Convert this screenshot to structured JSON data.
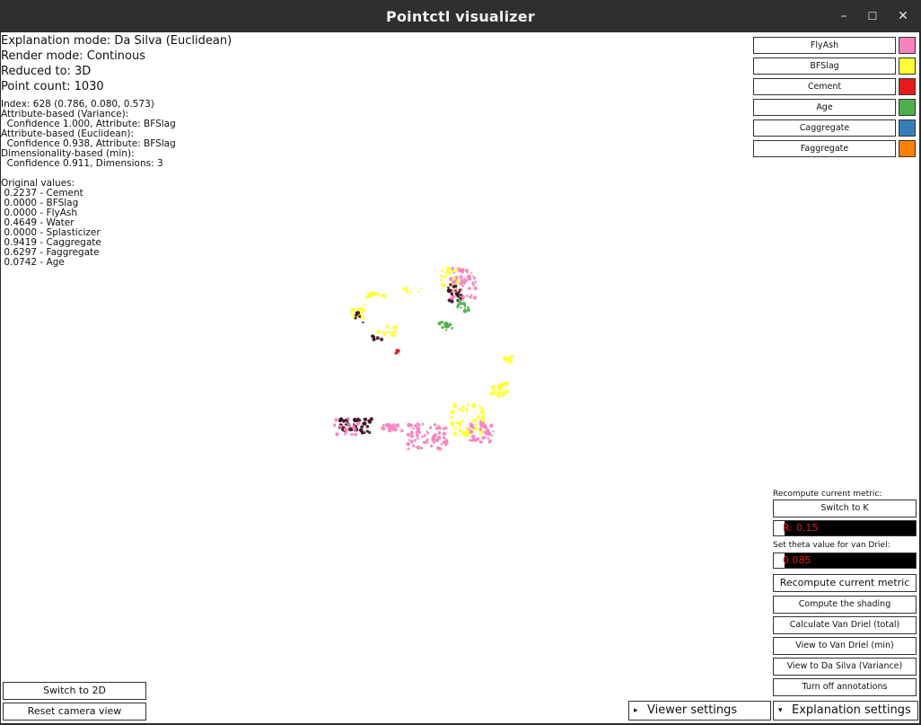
{
  "window": {
    "title": "Pointctl visualizer",
    "controls": {
      "minimize": "–",
      "maximize": "☐",
      "close": "✕"
    }
  },
  "info": {
    "explanation_mode": "Explanation mode: Da Silva (Euclidean)",
    "render_mode": "Render mode: Continous",
    "reduced_to": "Reduced to: 3D",
    "point_count": "Point count: 1030",
    "index": "Index: 628 (0.786, 0.080, 0.573)",
    "attr_variance_title": "Attribute-based (Variance):",
    "attr_variance_value": "  Confidence 1.000, Attribute: BFSlag",
    "attr_euclid_title": "Attribute-based (Euclidean):",
    "attr_euclid_value": "  Confidence 0.938, Attribute: BFSlag",
    "dim_title": "Dimensionality-based (min):",
    "dim_value": "  Confidence 0.911, Dimensions: 3",
    "original_title": "Original values:",
    "original_values": [
      " 0.2237 - Cement",
      " 0.0000 - BFSlag",
      " 0.0000 - FlyAsh",
      " 0.4649 - Water",
      " 0.0000 - Splasticizer",
      " 0.9419 - Caggregate",
      " 0.6297 - Faggregate",
      " 0.0742 - Age"
    ]
  },
  "legend": [
    {
      "label": "FlyAsh",
      "color": "#f781bf"
    },
    {
      "label": "BFSlag",
      "color": "#ffff33"
    },
    {
      "label": "Cement",
      "color": "#e41a1c"
    },
    {
      "label": "Age",
      "color": "#4daf4a"
    },
    {
      "label": "Caggregate",
      "color": "#377eb8"
    },
    {
      "label": "Faggregate",
      "color": "#ff7f00"
    }
  ],
  "right_panel": {
    "recompute_label": "Recompute current metric:",
    "switch_k": "Switch to K",
    "r_label": "R:",
    "r_value": "0.15",
    "theta_label": "Set theta value for van Driel:",
    "theta_value": "0.085",
    "recompute_button": "Recompute current metric",
    "compute_shading": "Compute the shading",
    "calc_van_driel": "Calculate Van Driel (total)",
    "view_van_driel": "View to Van Driel (min)",
    "view_da_silva": "View to Da Silva (Variance)",
    "turn_off_annotations": "Turn off annotations"
  },
  "bottom": {
    "switch_2d": "Switch to 2D",
    "reset_camera": "Reset camera view",
    "viewer_settings": "Viewer settings",
    "explanation_settings": "Explanation settings",
    "viewer_arrow": "▸",
    "explanation_arrow": "▾"
  },
  "colors": {
    "pink": "#f781bf",
    "yellow": "#ffff33",
    "red": "#e41a1c",
    "green": "#4daf4a",
    "blue": "#377eb8",
    "orange": "#ff7f00",
    "dark": "#3b0f1e"
  }
}
